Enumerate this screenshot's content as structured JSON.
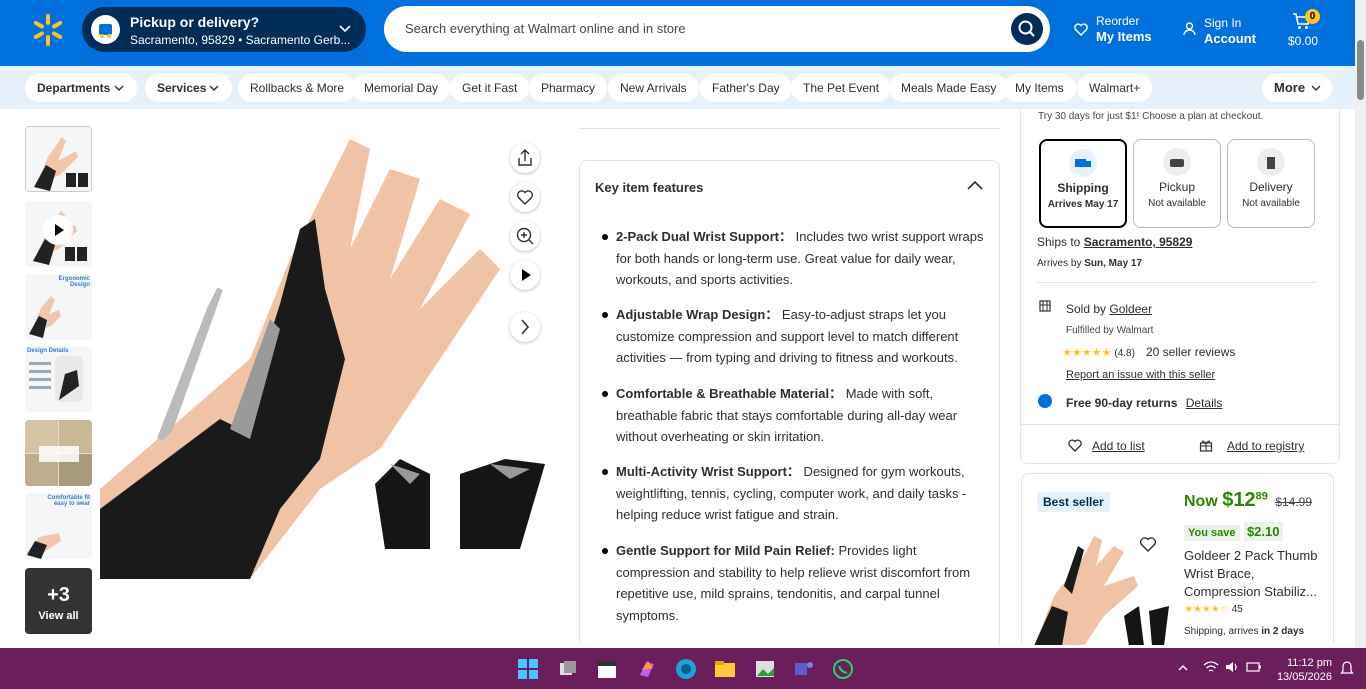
{
  "header": {
    "pickup_title": "Pickup or delivery?",
    "pickup_location": "Sacramento, 95829 • Sacramento Gerb...",
    "search_placeholder": "Search everything at Walmart online and in store",
    "reorder_top": "Reorder",
    "reorder_bottom": "My Items",
    "signin_top": "Sign In",
    "signin_bottom": "Account",
    "cart_count": "0",
    "cart_total": "$0.00"
  },
  "nav": {
    "items": [
      "Departments",
      "Services",
      "Rollbacks & More",
      "Memorial Day",
      "Get it Fast",
      "Pharmacy",
      "New Arrivals",
      "Father's Day",
      "The Pet Event",
      "Meals Made Easy",
      "My Items",
      "Walmart+"
    ],
    "more": "More"
  },
  "gallery": {
    "view_all_count": "+3",
    "view_all_label": "View all",
    "thumb3_label": "Ergonomic Design",
    "thumb4_label": "Design Details",
    "thumb6_label": "Comfortable fit easy to wear"
  },
  "features": {
    "title": "Key item features",
    "items": [
      {
        "bold": "2-Pack Dual Wrist Support：",
        "text": " Includes two wrist support wraps for both hands or long-term use. Great value for daily wear, workouts, and sports activities."
      },
      {
        "bold": "Adjustable Wrap Design：",
        "text": " Easy-to-adjust straps let you customize compression and support level to match different activities — from typing and driving to fitness and workouts."
      },
      {
        "bold": "Comfortable & Breathable Material：",
        "text": " Made with soft, breathable fabric that stays comfortable during all-day wear without overheating or skin irritation."
      },
      {
        "bold": "Multi-Activity Wrist Support：",
        "text": " Designed for gym workouts, weightlifting, tennis, cycling, computer work, and daily tasks - helping reduce wrist fatigue and strain."
      },
      {
        "bold": "Gentle Support for Mild Pain Relief:",
        "text": " Provides light compression and stability to help relieve wrist discomfort from repetitive use, mild sprains, tendonitis, and carpal tunnel symptoms."
      }
    ]
  },
  "fulfillment": {
    "trial_text": "Try 30 days for just $1! Choose a plan at checkout.",
    "options": [
      {
        "name": "Shipping",
        "status": "Arrives May 17"
      },
      {
        "name": "Pickup",
        "status": "Not available"
      },
      {
        "name": "Delivery",
        "status": "Not available"
      }
    ],
    "ships_to_label": "Ships to",
    "ships_to_location": "Sacramento, 95829",
    "arrives_label": "Arrives by",
    "arrives_date": "Sun, May 17",
    "sold_by_label": "Sold by",
    "seller": "Goldeer",
    "fulfilled": "Fulfilled by Walmart",
    "rating": "(4.8)",
    "seller_reviews": "20 seller reviews",
    "report": "Report an issue with this seller",
    "returns": "Free 90-day returns",
    "returns_details": "Details",
    "add_to_list": "Add to list",
    "add_to_registry": "Add to registry"
  },
  "promo": {
    "badge": "Best seller",
    "now_label": "Now",
    "price_dollars": "$12",
    "price_cents": "89",
    "was_price": "$14.99",
    "save_label": "You save",
    "save_amount": "$2.10",
    "title": "Goldeer 2 Pack Thumb Wrist Brace, Compression Stabiliz...",
    "rating_count": "45",
    "shipping_label": "Shipping, arrives",
    "shipping_when": "in 2 days"
  },
  "taskbar": {
    "time": "11:12 pm",
    "date": "13/05/2026"
  },
  "colors": {
    "walmart_blue": "#0071dc",
    "dark_blue": "#002d58",
    "spark_yellow": "#ffc220",
    "price_green": "#2a8703",
    "taskbar": "#6b1e5c"
  }
}
